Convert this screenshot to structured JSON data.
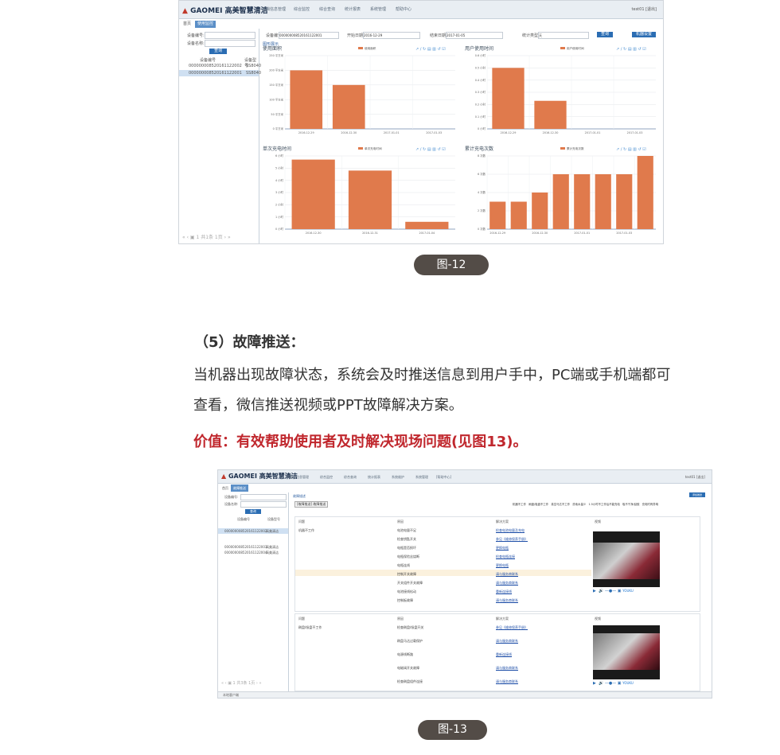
{
  "fig12": {
    "logo": "GAOMEI",
    "logo_cn": "高美智慧清洁",
    "nav": [
      "基础信息管理",
      "综合监控",
      "综合查询",
      "统计报表",
      "系统管理",
      "帮助中心"
    ],
    "user": "test01 [退出]",
    "tabs": [
      "首页",
      "使用监控"
    ],
    "left_labels": [
      "设备编号:",
      "设备名称:"
    ],
    "search_btn": "查询",
    "list_header": [
      "设备编号",
      "设备型号"
    ],
    "list_rows": [
      {
        "id": "000000008520161122002",
        "model": "SS8040"
      },
      {
        "id": "000000008520161122001",
        "model": "SS8040"
      }
    ],
    "pager": "共1条 1页",
    "filter": {
      "device_value": "000000008520161122001",
      "start_label": "开始日期",
      "start_value": "2016-12-29",
      "end_label": "结束日期",
      "end_value": "2017-01-05",
      "type_label": "统计类型",
      "type_value": "天",
      "query_btn": "查询",
      "export_btn": "机器设置"
    },
    "section": "图形展示",
    "colors": {
      "bar": "#e07a4c",
      "accent": "#2b6db3"
    }
  },
  "chart_data": [
    {
      "type": "bar",
      "title": "使用面积",
      "legend": "使用面积",
      "categories": [
        "2016-12-29",
        "2016-12-30",
        "2017-01-01",
        "2017-01-03"
      ],
      "values": [
        200,
        150,
        0,
        0
      ],
      "ylim": [
        0,
        250
      ],
      "yticks": [
        "0 平方米",
        "50 平方米",
        "100 平方米",
        "150 平方米",
        "200 平方米",
        "250 平方米"
      ]
    },
    {
      "type": "bar",
      "title": "用户使用时间",
      "legend": "用户使用时间",
      "categories": [
        "2016-12-29",
        "2016-12-30",
        "2017-01-01",
        "2017-01-03"
      ],
      "values": [
        0.5,
        0.23,
        0,
        0
      ],
      "ylim": [
        0,
        0.6
      ],
      "yticks": [
        "0 小时",
        "0.1 小时",
        "0.2 小时",
        "0.3 小时",
        "0.4 小时",
        "0.5 小时",
        "0.6 小时"
      ]
    },
    {
      "type": "bar",
      "title": "单次充电时间",
      "legend": "单次充电时间",
      "categories": [
        "2016-12-30",
        "2016-12-31",
        "2017-01-04"
      ],
      "values": [
        5.7,
        4.8,
        0.6
      ],
      "ylim": [
        0,
        6
      ],
      "yticks": [
        "0 小时",
        "1 小时",
        "2 小时",
        "3 小时",
        "4 小时",
        "5 小时",
        "6 小时"
      ]
    },
    {
      "type": "bar",
      "title": "累计充电次数",
      "legend": "累计充电次数",
      "categories": [
        "2016-12-29",
        "",
        "2016-12-30",
        "",
        "2017-01-01",
        "",
        "2017-01-03",
        ""
      ],
      "values": [
        3,
        3,
        4,
        6,
        6,
        6,
        6,
        8
      ],
      "ylim": [
        0,
        8
      ],
      "yticks": [
        "0 次数",
        "2 次数",
        "4 次数",
        "6 次数",
        "8 次数"
      ]
    }
  ],
  "caption12": "图-12",
  "section5": {
    "heading": "（5）故障推送：",
    "line1": "当机器出现故障状态，系统会及时推送信息到用户手中，PC端或手机端都可",
    "line2": "查看，微信推送视频或PPT故障解决方案。",
    "value": "价值：有效帮助使用者及时解决现场问题(见图13)。"
  },
  "fig13": {
    "logo": "GAOMEI",
    "logo_cn": "高美智慧清洁",
    "nav": [
      "基础信息管理",
      "综合监控",
      "综合查询",
      "统计报表",
      "系统维护",
      "系统管理",
      "[帮助中心]"
    ],
    "user": "test01 [退出]",
    "tabs": [
      "首页",
      "故障推送"
    ],
    "left_labels": [
      "设备编号:",
      "设备名称:"
    ],
    "search_btn": "查询",
    "list_header": [
      "设备编号",
      "设备型号"
    ],
    "list_rows": [
      {
        "id": "000000008520161122002",
        "model": "高美清洁"
      },
      {
        "id": "000000008520161122003",
        "model": "高美清洁"
      },
      {
        "id": "000000008520161122004",
        "model": "高美清洁"
      }
    ],
    "section_title": "故障描述",
    "filter_btn": "[故障推送] 故障推送",
    "tabs_right": [
      "机器不工作",
      "刷盘/吸盘不工作",
      "真空马达不工作",
      "洗地水量少",
      "1.5小时不工作后不能充电",
      "吸不干净/刮胶",
      "充电时有异响"
    ],
    "table_headers": [
      "问题",
      "原因",
      "解决方案",
      "视频"
    ],
    "block1_problem": "机器不工作",
    "block1_reasons": [
      "电池电量不足",
      "检查钥匙开关",
      "电瓶是否损坏",
      "电瓶保险丝烧断",
      "电瓶连线",
      "控制开关故障",
      "开关组件开关故障",
      "电池接线松动",
      "控制板故障"
    ],
    "block1_solutions": [
      "检查电池电量及充电",
      "参见《维修保养手册》",
      "更换电瓶",
      "检查电瓶连接",
      "更换电瓶",
      "请与服务商联系",
      "请与服务商联系",
      "重新连接线",
      "请与服务商联系"
    ],
    "block2_problem": "刷盘/吸盘不工作",
    "block2_reasons": [
      "检查刷盘/吸盘开关",
      "刷盘马达过载保护",
      "电源线断路",
      "电磁阀开关故障",
      "检查刷盘组件连接"
    ],
    "block2_solutions": [
      "参见《维修保养手册》",
      "请与服务商联系",
      "重新连接线",
      "请与服务商联系",
      "请与服务商联系"
    ],
    "video_brand": "YOUKU",
    "status": "本地客户端",
    "pager": "共3条 1页"
  },
  "caption13": "图-13"
}
